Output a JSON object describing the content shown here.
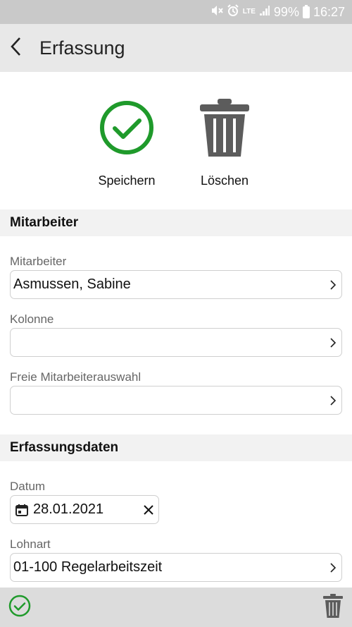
{
  "status_bar": {
    "battery": "99%",
    "time": "16:27",
    "network": "LTE",
    "icons": [
      "mute-icon",
      "alarm-icon",
      "lte-icon",
      "signal-icon",
      "battery-icon"
    ]
  },
  "app_bar": {
    "title": "Erfassung"
  },
  "actions": {
    "save_label": "Speichern",
    "delete_label": "Löschen",
    "save_color": "#1f9a2b",
    "delete_color": "#5c5c5c"
  },
  "sections": {
    "employee": {
      "title": "Mitarbeiter",
      "employee_label": "Mitarbeiter",
      "employee_value": "Asmussen, Sabine",
      "column_label": "Kolonne",
      "column_value": "",
      "free_selection_label": "Freie Mitarbeiterauswahl",
      "free_selection_value": ""
    },
    "capture_data": {
      "title": "Erfassungsdaten",
      "date_label": "Datum",
      "date_value": "28.01.2021",
      "wage_type_label": "Lohnart",
      "wage_type_value": "01-100 Regelarbeitszeit"
    }
  }
}
